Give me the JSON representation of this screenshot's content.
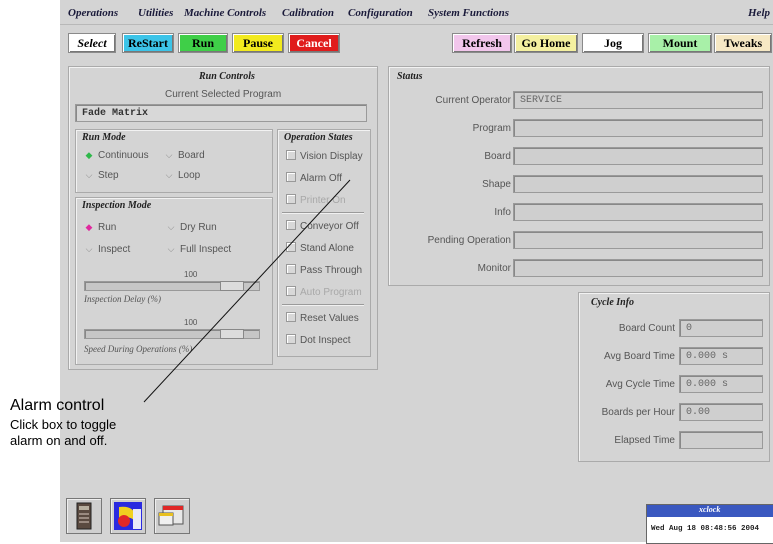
{
  "menubar": {
    "items": [
      "Operations",
      "Utilities",
      "Machine Controls",
      "Calibration",
      "Configuration",
      "System Functions"
    ],
    "help": "Help"
  },
  "toolbar": {
    "select": "Select",
    "restart": "ReStart",
    "run": "Run",
    "pause": "Pause",
    "cancel": "Cancel",
    "refresh": "Refresh",
    "go_home": "Go Home",
    "jog": "Jog",
    "mount": "Mount",
    "tweaks": "Tweaks",
    "colors": {
      "restart": "#3cc4e8",
      "run": "#3fcf48",
      "pause": "#f2ea1e",
      "cancel": "#e01c1c",
      "refresh": "#f2c6ec",
      "go_home": "#f4f0a0",
      "jog": "#ffffff",
      "mount": "#a8f0a8",
      "tweaks": "#f6e8c4"
    }
  },
  "run_controls": {
    "title": "Run Controls",
    "current_program_label": "Current Selected Program",
    "current_program_value": "Fade Matrix",
    "run_mode": {
      "title": "Run Mode",
      "options": [
        "Continuous",
        "Board",
        "Step",
        "Loop"
      ],
      "selected": "Continuous"
    },
    "inspection_mode": {
      "title": "Inspection Mode",
      "options": [
        "Run",
        "Dry Run",
        "Inspect",
        "Full Inspect"
      ],
      "selected": "Run"
    },
    "inspection_delay": {
      "value": "100",
      "label": "Inspection Delay (%)",
      "fraction": 0.9
    },
    "speed": {
      "value": "100",
      "label": "Speed During Operations (%)",
      "fraction": 0.9
    },
    "operation_states": {
      "title": "Operation States",
      "items": [
        "Vision Display",
        "Alarm Off",
        "Printer On",
        "Conveyor Off",
        "Stand Alone",
        "Pass Through",
        "Auto Program",
        "Reset Values",
        "Dot Inspect"
      ]
    }
  },
  "status": {
    "title": "Status",
    "labels": [
      "Current Operator",
      "Program",
      "Board",
      "Shape",
      "Info",
      "Pending Operation",
      "Monitor"
    ],
    "values": [
      "SERVICE",
      "",
      "",
      "",
      "",
      "",
      ""
    ]
  },
  "cycle_info": {
    "title": "Cycle Info",
    "labels": [
      "Board Count",
      "Avg Board Time",
      "Avg Cycle Time",
      "Boards per Hour",
      "Elapsed Time"
    ],
    "values": [
      "0",
      "0.000 s",
      "0.000 s",
      "0.00",
      ""
    ]
  },
  "annotation": {
    "title": "Alarm control",
    "line1": "Click box to toggle",
    "line2": "alarm on and off."
  },
  "taskbar": {
    "icons": [
      "device-icon",
      "paint-icon",
      "window-manager-icon"
    ]
  },
  "xclock": {
    "title": "xclock",
    "datetime": "Wed Aug 18 08:48:56 2004"
  }
}
